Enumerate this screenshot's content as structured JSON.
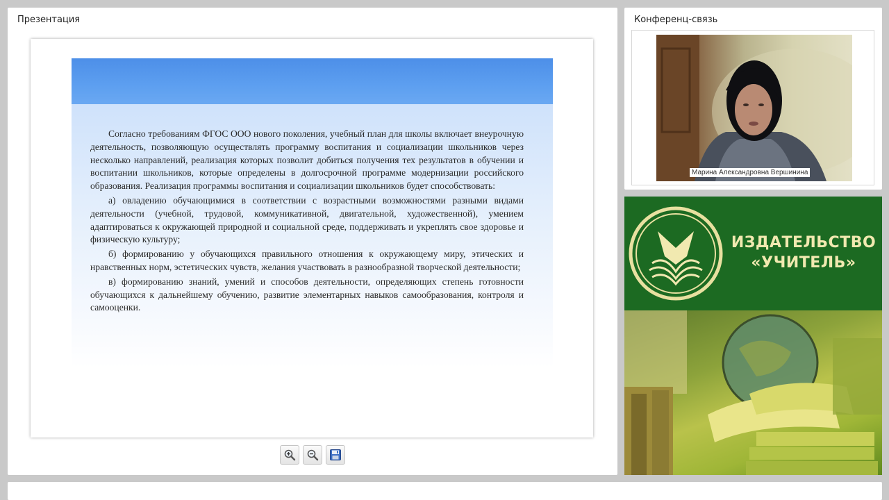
{
  "presentation": {
    "title": "Презентация",
    "slide": {
      "paragraphs": [
        "Согласно требованиям ФГОС ООО нового поколения, учебный план для школы включает внеурочную деятельность, позволяющую осуществлять программу воспитания и социализации школьников через несколько направлений, реализация которых позволит добиться получения тех результатов в обучении и воспитании школьников, которые определены в долгосрочной программе модернизации российского образования. Реализация программы воспитания и социализации школьников будет способствовать:",
        "а) овладению обучающимися в соответствии с возрастными возможностями разными видами деятельности (учебной, трудовой, коммуникативной, двигательной, художественной), умением адаптироваться к окружающей природной и социальной среде, поддерживать и укреплять свое здоровье и физическую культуру;",
        "б) формированию у обучающихся правильного отношения к окружающему миру, этических и нравственных норм, эстетических чувств, желания участвовать в разнообразной творческой деятельности;",
        "в) формированию знаний, умений и способов деятельности, определяющих степень готовности обучающихся к дальнейшему обучению, развитие элементарных навыков самообразования, контроля и самооценки."
      ]
    },
    "toolbar": {
      "icons": [
        "zoom-in-icon",
        "zoom-out-icon",
        "save-icon"
      ]
    }
  },
  "conference": {
    "title": "Конференц-связь",
    "participant_name": "Марина Александровна Вершинина"
  },
  "publisher": {
    "name_line1": "ИЗДАТЕЛЬСТВО",
    "name_line2": "«УЧИТЕЛЬ»"
  },
  "colors": {
    "slide_header_blue": "#5d9ff0",
    "publisher_green": "#1c6a22",
    "publisher_text": "#f1e9b0"
  }
}
